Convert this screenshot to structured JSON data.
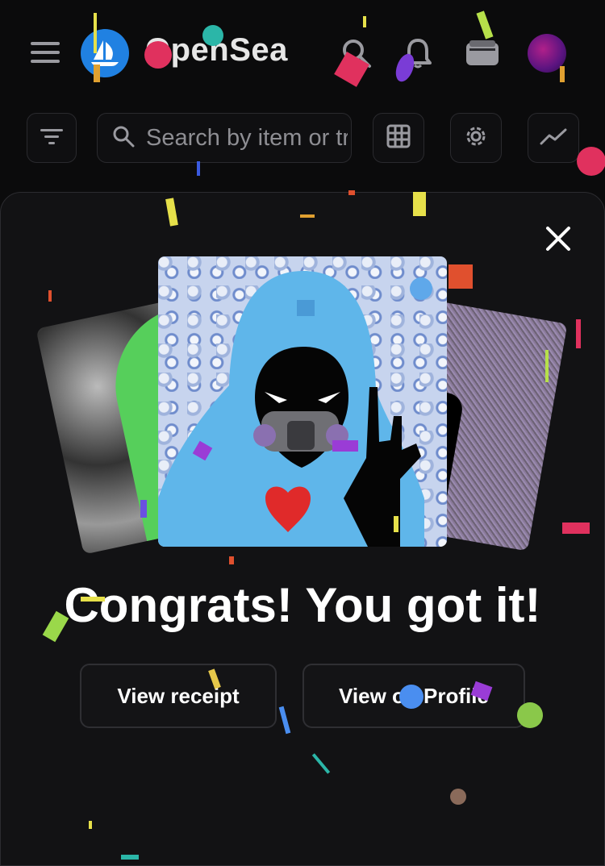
{
  "header": {
    "brand": "OpenSea",
    "menu_icon": "hamburger-menu-icon",
    "logo_icon": "opensea-boat-logo",
    "search_icon": "search-icon",
    "notifications_icon": "bell-icon",
    "wallet_icon": "wallet-icon",
    "profile_icon": "avatar"
  },
  "toolbar": {
    "filter_icon": "filter-icon",
    "search_placeholder": "Search by item or trait",
    "grid_icon": "grid-view-icon",
    "settings_icon": "gear-icon",
    "activity_icon": "activity-chart-icon"
  },
  "modal": {
    "close_icon": "close-icon",
    "headline": "Congrats! You got it!",
    "receipt_button": "View receipt",
    "profile_button": "View on Profile"
  },
  "colors": {
    "background": "#0b0b0c",
    "modal_background": "#121214",
    "brand_blue": "#2081e2",
    "text": "#ffffff"
  }
}
